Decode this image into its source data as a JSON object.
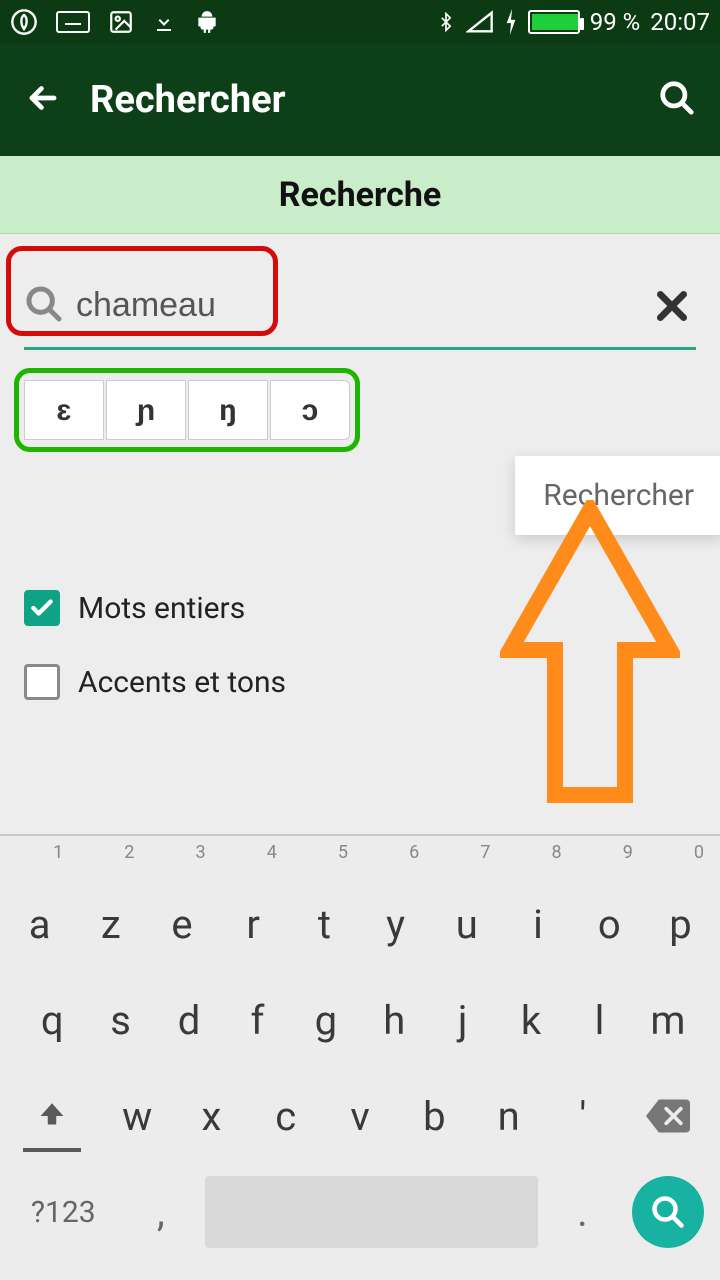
{
  "status": {
    "battery_pct": "99 %",
    "time": "20:07"
  },
  "appbar": {
    "title": "Rechercher"
  },
  "subheader": {
    "title": "Recherche"
  },
  "search": {
    "value": "chameau"
  },
  "special_chars": [
    "ɛ",
    "ɲ",
    "ŋ",
    "ɔ"
  ],
  "popup": {
    "label": "Rechercher"
  },
  "options": {
    "whole_words": {
      "label": "Mots entiers",
      "checked": true
    },
    "accents": {
      "label": "Accents et tons",
      "checked": false
    }
  },
  "keyboard": {
    "hints": [
      "1",
      "2",
      "3",
      "4",
      "5",
      "6",
      "7",
      "8",
      "9",
      "0"
    ],
    "row1": [
      "a",
      "z",
      "e",
      "r",
      "t",
      "y",
      "u",
      "i",
      "o",
      "p"
    ],
    "row2": [
      "q",
      "s",
      "d",
      "f",
      "g",
      "h",
      "j",
      "k",
      "l",
      "m"
    ],
    "row3": [
      "w",
      "x",
      "c",
      "v",
      "b",
      "n",
      "'"
    ],
    "symkey": "?123",
    "comma": ",",
    "dot": "."
  }
}
